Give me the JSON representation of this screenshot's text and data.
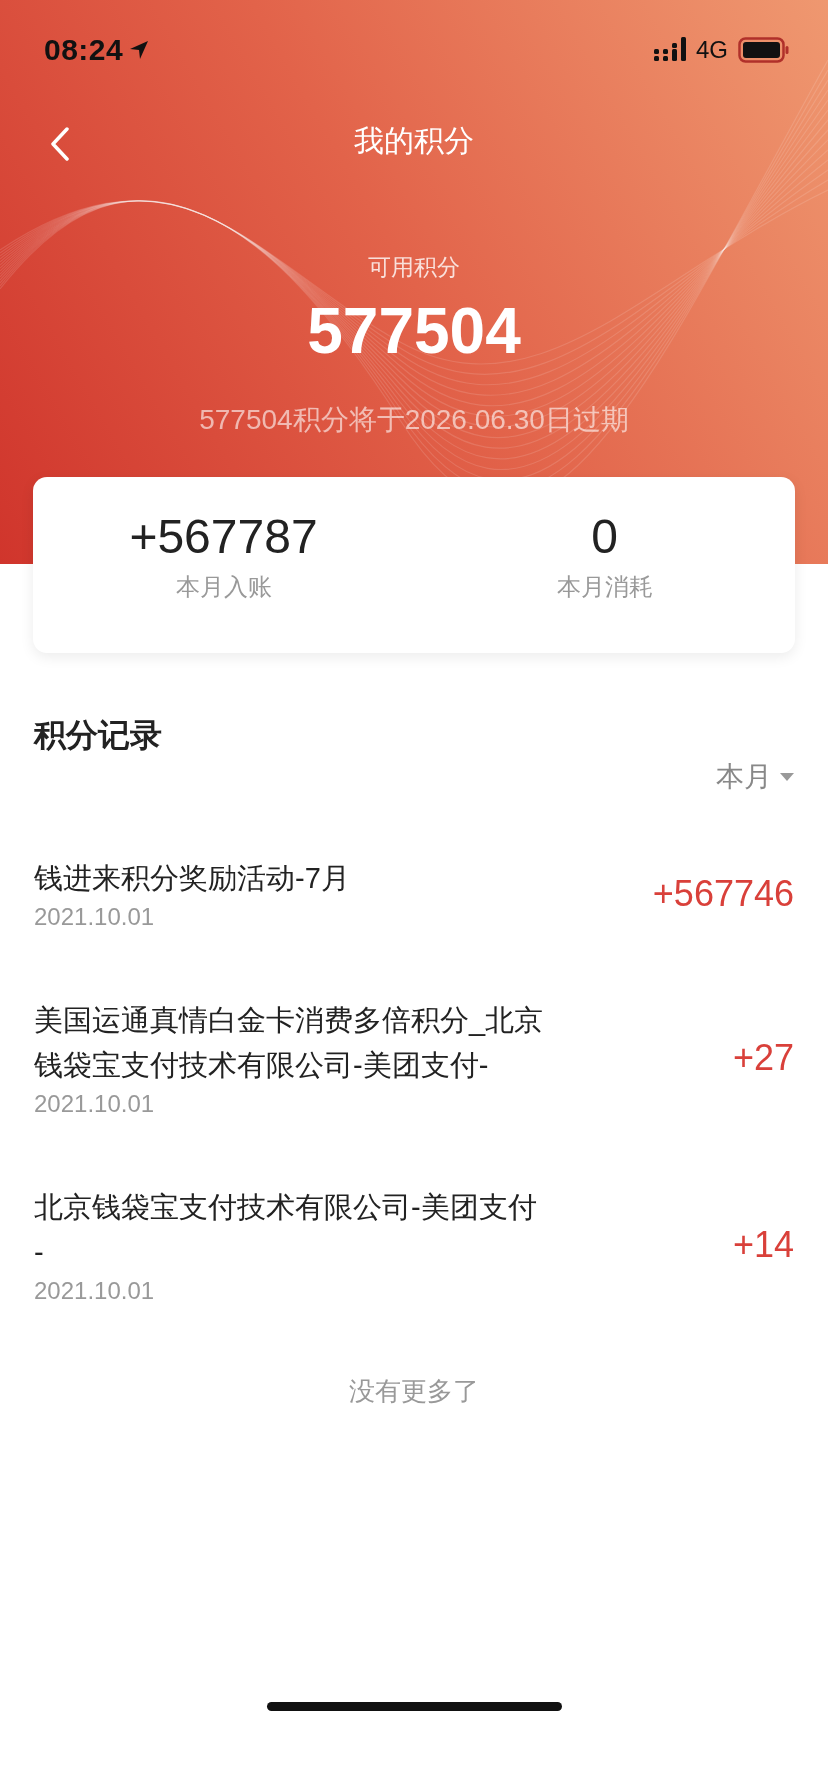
{
  "status_bar": {
    "time": "08:24",
    "network": "4G"
  },
  "nav": {
    "title": "我的积分"
  },
  "balance": {
    "label": "可用积分",
    "value": "577504",
    "expiry_note": "577504积分将于2026.06.30日过期"
  },
  "summary": [
    {
      "value": "+567787",
      "label": "本月入账"
    },
    {
      "value": "0",
      "label": "本月消耗"
    }
  ],
  "records": {
    "title": "积分记录",
    "filter": "本月",
    "items": [
      {
        "title_lines": [
          "钱进来积分奖励活动-7月"
        ],
        "date": "2021.10.01",
        "amount": "+567746"
      },
      {
        "title_lines": [
          "美国运通真情白金卡消费多倍积分_北京",
          "钱袋宝支付技术有限公司-美团支付-"
        ],
        "date": "2021.10.01",
        "amount": "+27"
      },
      {
        "title_lines": [
          "北京钱袋宝支付技术有限公司-美团支付",
          "-"
        ],
        "date": "2021.10.01",
        "amount": "+14"
      }
    ],
    "end_note": "没有更多了"
  }
}
